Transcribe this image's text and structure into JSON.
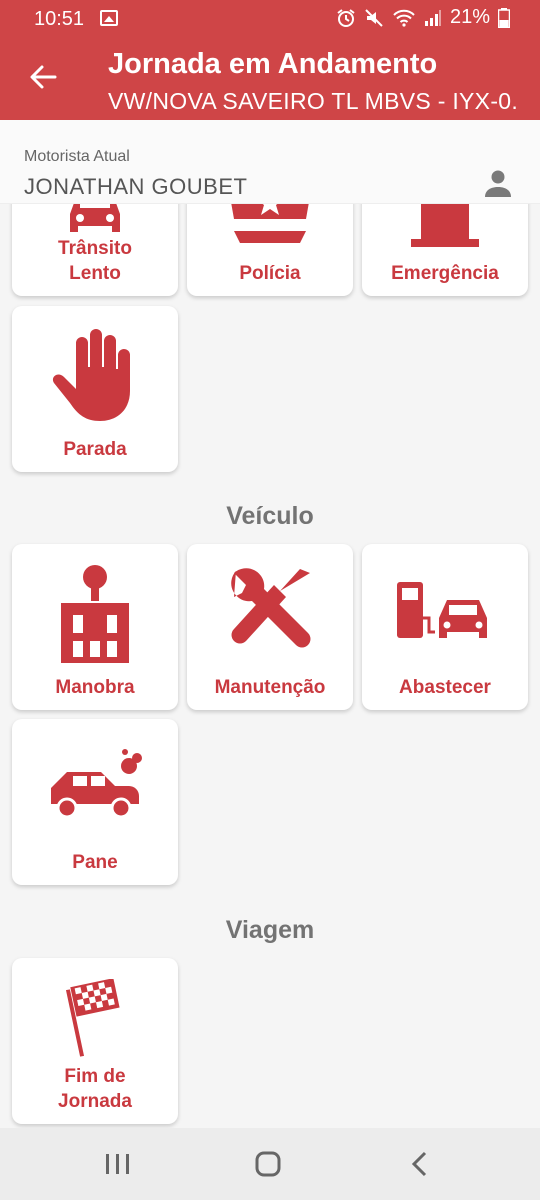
{
  "status_bar": {
    "time": "10:51",
    "battery": "21%"
  },
  "app_bar": {
    "title": "Jornada em Andamento",
    "subtitle": "VW/NOVA SAVEIRO TL MBVS - IYX-0..."
  },
  "driver": {
    "label": "Motorista Atual",
    "name": "JONATHAN GOUBET"
  },
  "sections": {
    "veiculo": "Veículo",
    "viagem": "Viagem"
  },
  "cards": {
    "transito": "Trânsito\nLento",
    "policia": "Polícia",
    "emergencia": "Emergência",
    "parada": "Parada",
    "manobra": "Manobra",
    "manutencao": "Manutenção",
    "abastecer": "Abastecer",
    "pane": "Pane",
    "fim": "Fim de\nJornada"
  },
  "icons": {
    "transito": "car-traffic-icon",
    "policia": "police-cap-icon",
    "emergencia": "siren-icon",
    "parada": "hand-stop-icon",
    "manobra": "gear-shift-icon",
    "manutencao": "tools-icon",
    "abastecer": "fuel-pump-icon",
    "pane": "car-smoke-icon",
    "fim": "checkered-flag-icon"
  },
  "colors": {
    "primary": "#cf4547",
    "accent_text": "#c9393f"
  }
}
